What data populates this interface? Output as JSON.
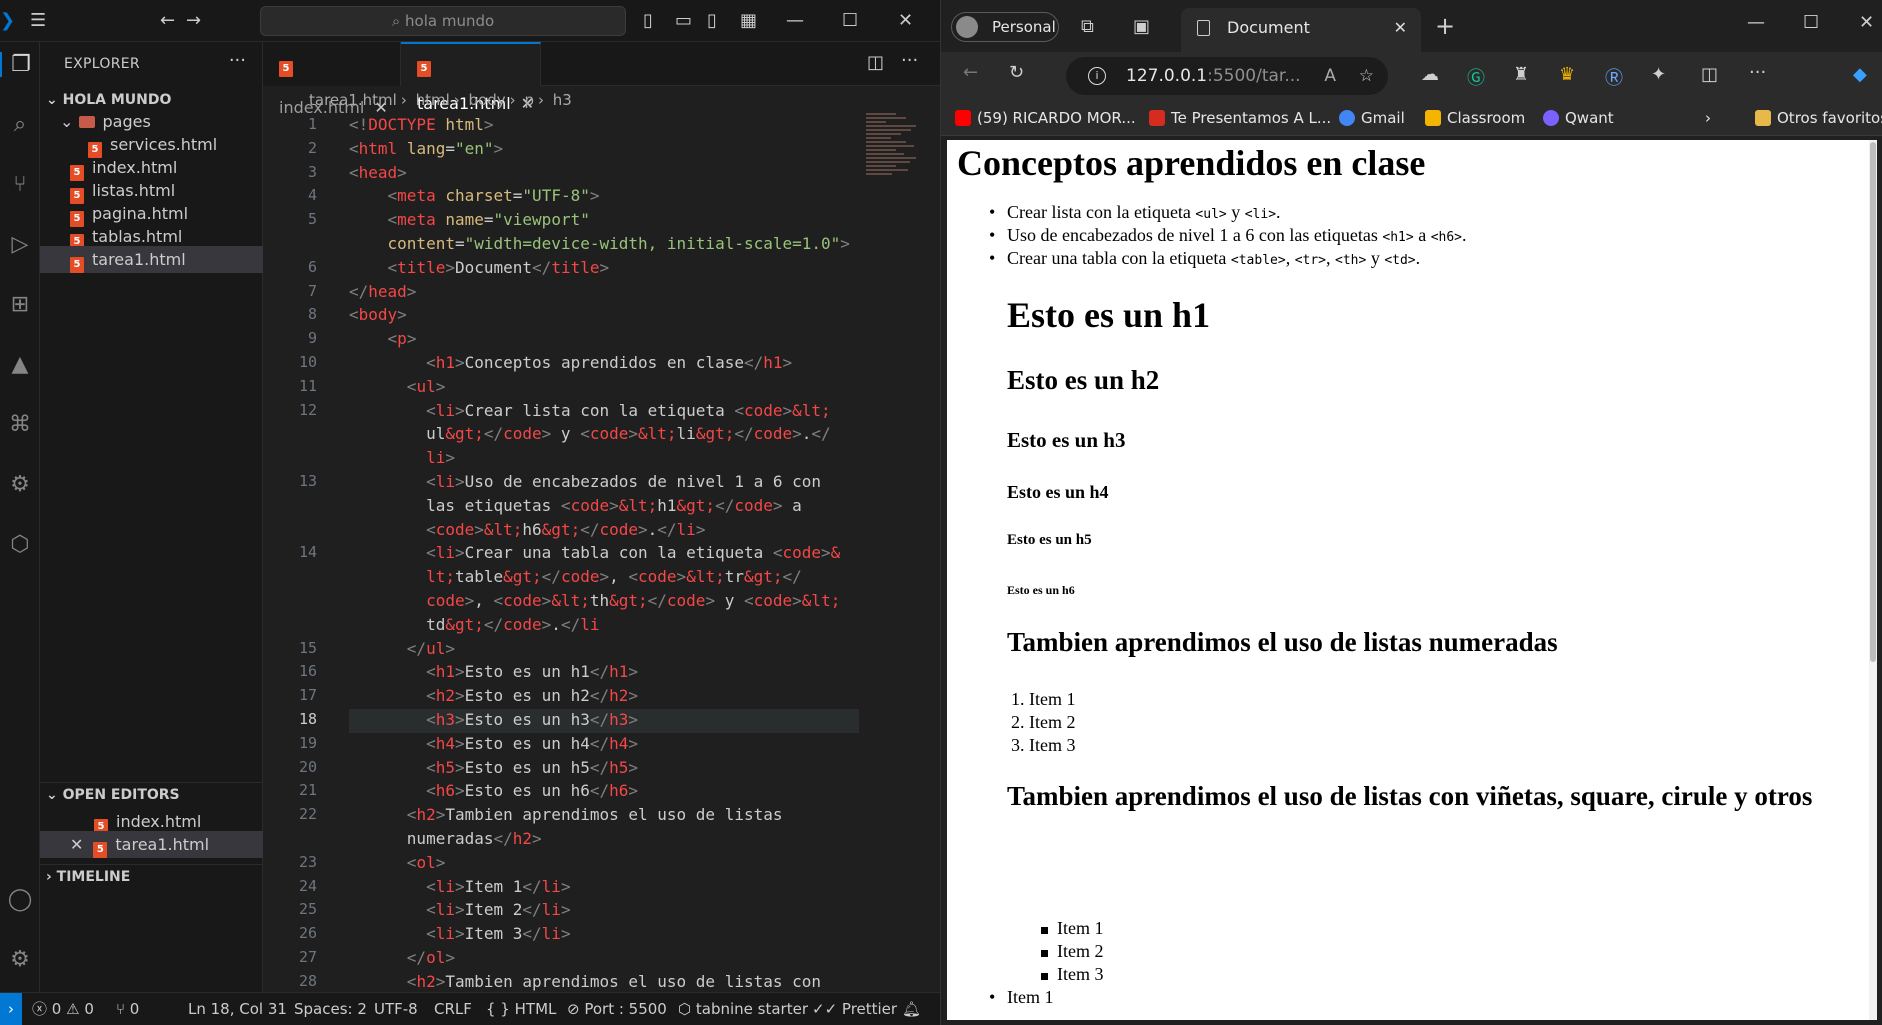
{
  "vscode": {
    "search_placeholder": "hola mundo",
    "explorer_label": "EXPLORER",
    "folder_name": "HOLA MUNDO",
    "tree": [
      {
        "label": "pages"
      },
      {
        "label": "services.html"
      },
      {
        "label": "index.html"
      },
      {
        "label": "listas.html"
      },
      {
        "label": "pagina.html"
      },
      {
        "label": "tablas.html"
      },
      {
        "label": "tarea1.html"
      }
    ],
    "open_editors_label": "OPEN EDITORS",
    "open_editors": [
      {
        "label": "index.html"
      },
      {
        "label": "tarea1.html"
      }
    ],
    "timeline_label": "TIMELINE",
    "tabs": [
      {
        "label": "index.html"
      },
      {
        "label": "tarea1.html"
      }
    ],
    "breadcrumb": [
      "tarea1.html",
      "html",
      "body",
      "p",
      "h3"
    ],
    "line_numbers": [
      "1",
      "2",
      "3",
      "4",
      "5",
      "",
      "6",
      "7",
      "8",
      "9",
      "10",
      "11",
      "12",
      "",
      "",
      "13",
      "",
      "",
      "14",
      "",
      "",
      "",
      "15",
      "16",
      "17",
      "18",
      "19",
      "20",
      "21",
      "22",
      "",
      "23",
      "24",
      "25",
      "26",
      "27",
      "28"
    ],
    "current_line": "18",
    "status": {
      "problems": "0",
      "warnings": "0",
      "ports": "0",
      "position": "Ln 18, Col 31",
      "spaces": "Spaces: 2",
      "encoding": "UTF-8",
      "eol": "CRLF",
      "language": "HTML",
      "port": "Port : 5500",
      "tabnine": "tabnine starter",
      "prettier": "Prettier"
    }
  },
  "browser": {
    "profile": "Personal",
    "tab_title": "Document",
    "url_main": "127.0.0.1",
    "url_rest": ":5500/tar...",
    "bookmarks": [
      {
        "label": "(59) RICARDO MOR...",
        "color": "#ff0000"
      },
      {
        "label": "Te Presentamos A L...",
        "color": "#d62b1f"
      },
      {
        "label": "Gmail",
        "color": "#4285f4"
      },
      {
        "label": "Classroom",
        "color": "#f4b400"
      },
      {
        "label": "Qwant",
        "color": "#7b61ff"
      }
    ],
    "other_favorites": "Otros favoritos",
    "page": {
      "h1": "Conceptos aprendidos en clase",
      "list1": [
        {
          "pre": "Crear lista con la etiqueta ",
          "c1": "<ul>",
          "mid": " y ",
          "c2": "<li>",
          "post": "."
        },
        {
          "pre": "Uso de encabezados de nivel 1 a 6 con las etiquetas ",
          "c1": "<h1>",
          "mid": " a ",
          "c2": "<h6>",
          "post": "."
        },
        {
          "pre": "Crear una tabla con la etiqueta ",
          "c1": "<table>",
          "mid1": ", ",
          "c2": "<tr>",
          "mid2": ", ",
          "c3": "<th>",
          "mid3": " y ",
          "c4": "<td>",
          "post": "."
        }
      ],
      "h1b": "Esto es un h1",
      "h2": "Esto es un h2",
      "h3": "Esto es un h3",
      "h4": "Esto es un h4",
      "h5": "Esto es un h5",
      "h6": "Esto es un h6",
      "h2_numbered": "Tambien aprendimos el uso de listas numeradas",
      "ol": [
        "Item 1",
        "Item 2",
        "Item 3"
      ],
      "h2_bullets": "Tambien aprendimos el uso de listas con viñetas, square, cirule y otros",
      "ul_square": [
        "Item 1",
        "Item 2",
        "Item 3"
      ],
      "last_item": "Item 1"
    }
  }
}
